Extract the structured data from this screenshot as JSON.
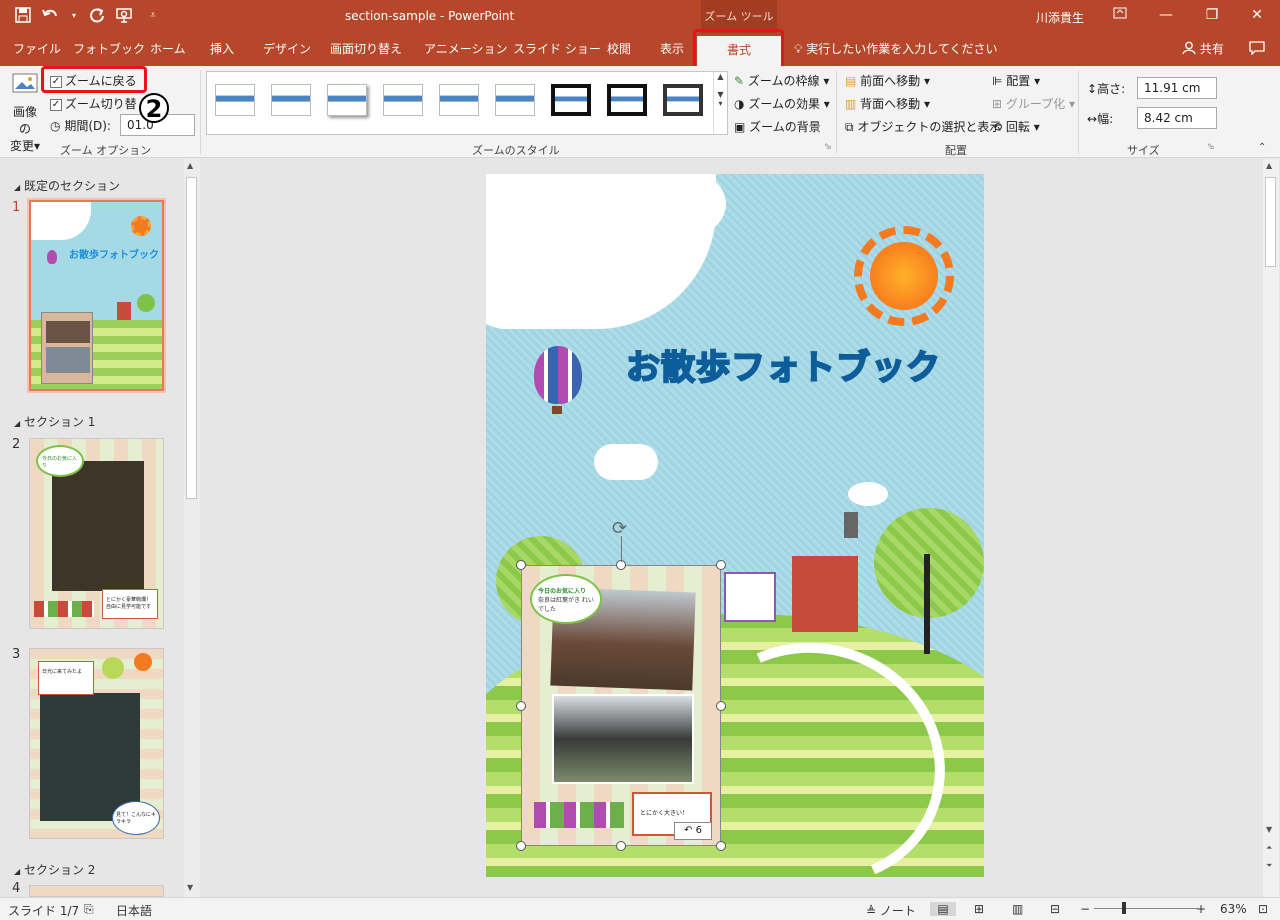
{
  "app": {
    "window_title": "section-sample - PowerPoint",
    "context_tab_group": "ズーム ツール",
    "user": "川添貴生"
  },
  "qat": {
    "save": "save-icon",
    "undo": "undo-icon",
    "redo": "redo-icon",
    "present": "present-from-start-icon",
    "more": "customize-qat-icon"
  },
  "tabs": [
    "ファイル",
    "フォトブック",
    "ホーム",
    "挿入",
    "デザイン",
    "画面切り替え",
    "アニメーション",
    "スライド ショー",
    "校閲",
    "表示"
  ],
  "active_tab": "書式",
  "tell_me": "実行したい作業を入力してください",
  "share": "共有",
  "annotations": {
    "one": "1",
    "two": "2"
  },
  "ribbon": {
    "zoom_options": {
      "change_image": "画像の",
      "change_image2": "変更",
      "return_to_zoom": "ズームに戻る",
      "zoom_transition": "ズーム切り替",
      "duration_label": "期間(D):",
      "duration_value": "01.0",
      "group_label": "ズーム オプション"
    },
    "zoom_styles": {
      "group_label": "ズームのスタイル",
      "border": "ズームの枠線",
      "effects": "ズームの効果",
      "background": "ズームの背景"
    },
    "arrange": {
      "bring_forward": "前面へ移動",
      "send_backward": "背面へ移動",
      "selection_pane": "オブジェクトの選択と表示",
      "align": "配置",
      "group": "グループ化",
      "rotate": "回転",
      "group_label": "配置"
    },
    "size": {
      "height_label": "高さ:",
      "height_value": "11.91 cm",
      "width_label": "幅:",
      "width_value": "8.42 cm",
      "group_label": "サイズ"
    }
  },
  "sections": [
    {
      "name": "既定のセクション"
    },
    {
      "name": "セクション 1"
    },
    {
      "name": "セクション 2"
    }
  ],
  "slide_numbers": [
    "1",
    "2",
    "3",
    "4"
  ],
  "slide": {
    "title": "お散歩フォトブック",
    "bubble_heading": "今日のお気に入り",
    "bubble_text": "奈良は紅葉がき れいでした",
    "caption": "とにかく大きい！",
    "return_slide": "6"
  },
  "thumb_text": {
    "s1": "お散歩フォトブック",
    "s2_bubble": "今日のお気に入り",
    "s2_note": "とにかく豪華絢爛！ 自由に見学可能です",
    "s3_note": "日光に来てみたよ",
    "s3_bubble": "見て！こんなにキラキラ"
  },
  "status": {
    "slide": "スライド 1/7",
    "language": "日本語",
    "notes": "ノート",
    "zoom": "63%"
  },
  "colors": {
    "accent": "#b7472a",
    "selection": "#e8785a",
    "highlight": "#e8121b"
  }
}
